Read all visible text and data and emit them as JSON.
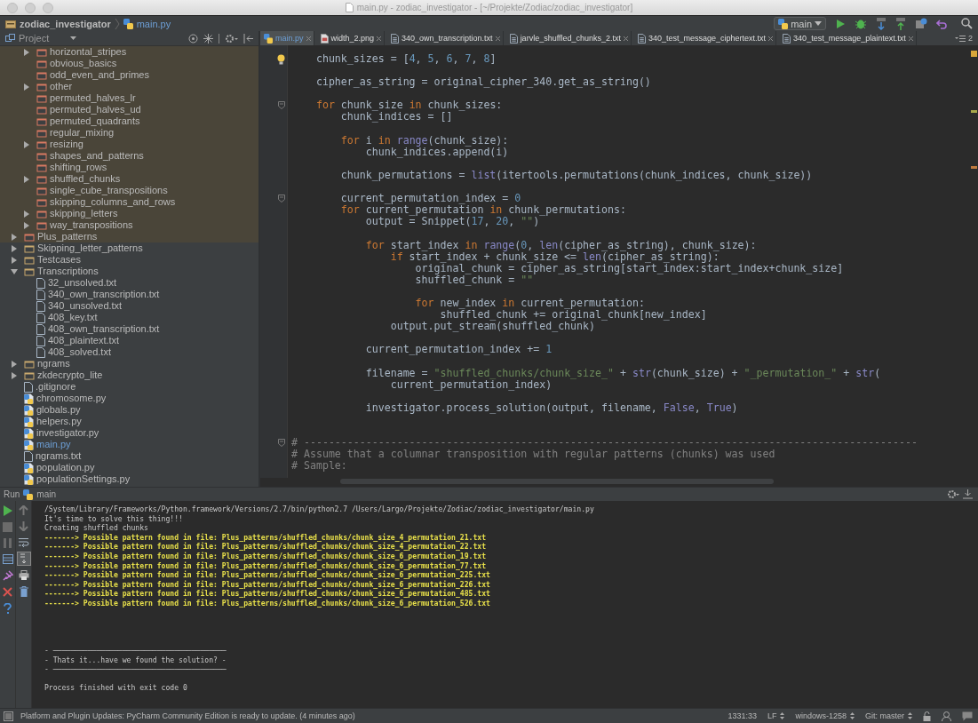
{
  "window": {
    "title": "main.py - zodiac_investigator - [~/Projekte/Zodiac/zodiac_investigator]"
  },
  "breadcrumb": [
    {
      "label": "zodiac_investigator",
      "kind": "folder"
    },
    {
      "label": "main.py",
      "kind": "python"
    }
  ],
  "run_config": "main",
  "project_panel": {
    "title": "Project"
  },
  "tree": [
    {
      "children": [
        {
          "label": "horizontal_stripes",
          "kind": "excluded_folder",
          "expanded": false,
          "highlighted": true
        },
        {
          "label": "obvious_basics",
          "kind": "excluded_folder",
          "highlighted": true
        },
        {
          "label": "odd_even_and_primes",
          "kind": "excluded_folder",
          "highlighted": true
        },
        {
          "label": "other",
          "kind": "excluded_folder",
          "expanded": false,
          "highlighted": true
        },
        {
          "label": "permuted_halves_lr",
          "kind": "excluded_folder",
          "highlighted": true
        },
        {
          "label": "permuted_halves_ud",
          "kind": "excluded_folder",
          "highlighted": true
        },
        {
          "label": "permuted_quadrants",
          "kind": "excluded_folder",
          "highlighted": true
        },
        {
          "label": "regular_mixing",
          "kind": "excluded_folder",
          "highlighted": true
        },
        {
          "label": "resizing",
          "kind": "excluded_folder",
          "expanded": false,
          "highlighted": true
        },
        {
          "label": "shapes_and_patterns",
          "kind": "excluded_folder",
          "highlighted": true
        },
        {
          "label": "shifting_rows",
          "kind": "excluded_folder",
          "highlighted": true
        },
        {
          "label": "shuffled_chunks",
          "kind": "excluded_folder",
          "expanded": false,
          "highlighted": true
        },
        {
          "label": "single_cube_transpositions",
          "kind": "excluded_folder",
          "highlighted": true
        },
        {
          "label": "skipping_columns_and_rows",
          "kind": "excluded_folder",
          "highlighted": true
        },
        {
          "label": "skipping_letters",
          "kind": "excluded_folder",
          "expanded": false,
          "highlighted": true
        },
        {
          "label": "way_transpositions",
          "kind": "excluded_folder",
          "expanded": false,
          "highlighted": true
        }
      ]
    },
    {
      "label": "Plus_patterns",
      "kind": "excluded_folder",
      "expanded": false,
      "highlighted": true
    },
    {
      "label": "Skipping_letter_patterns",
      "kind": "folder",
      "expanded": false,
      "highlighted": false
    },
    {
      "label": "Testcases",
      "kind": "folder",
      "expanded": false,
      "highlighted": false
    },
    {
      "label": "Transcriptions",
      "kind": "folder",
      "expanded": true,
      "highlighted": false,
      "children": [
        {
          "label": "32_unsolved.txt",
          "kind": "text",
          "highlighted": false,
          "active": false
        },
        {
          "label": "340_own_transcription.txt",
          "kind": "text",
          "highlighted": false,
          "active": false
        },
        {
          "label": "340_unsolved.txt",
          "kind": "text",
          "highlighted": false,
          "active": false
        },
        {
          "label": "408_key.txt",
          "kind": "text",
          "highlighted": false,
          "active": false
        },
        {
          "label": "408_own_transcription.txt",
          "kind": "text",
          "highlighted": false,
          "active": false
        },
        {
          "label": "408_plaintext.txt",
          "kind": "text",
          "highlighted": false,
          "active": false
        },
        {
          "label": "408_solved.txt",
          "kind": "text",
          "highlighted": false,
          "active": false
        }
      ]
    },
    {
      "label": "ngrams",
      "kind": "folder",
      "expanded": false,
      "highlighted": false
    },
    {
      "label": "zkdecrypto_lite",
      "kind": "folder",
      "expanded": false,
      "highlighted": false
    },
    {
      "label": ".gitignore",
      "kind": "text",
      "highlighted": false,
      "active": false
    },
    {
      "label": "chromosome.py",
      "kind": "python",
      "highlighted": false,
      "active": false
    },
    {
      "label": "globals.py",
      "kind": "python",
      "highlighted": false,
      "active": false
    },
    {
      "label": "helpers.py",
      "kind": "python",
      "highlighted": false,
      "active": false
    },
    {
      "label": "investigator.py",
      "kind": "python",
      "highlighted": false,
      "active": false
    },
    {
      "label": "main.py",
      "kind": "python",
      "highlighted": false,
      "active": true
    },
    {
      "label": "ngrams.txt",
      "kind": "text",
      "highlighted": false,
      "active": false
    },
    {
      "label": "population.py",
      "kind": "python",
      "highlighted": false,
      "active": false
    },
    {
      "label": "populationSettings.py",
      "kind": "python",
      "highlighted": false,
      "active": false
    }
  ],
  "tabs": [
    {
      "label": "main.py",
      "kind": "python",
      "selected": true
    },
    {
      "label": "width_2.png",
      "kind": "image",
      "selected": false
    },
    {
      "label": "340_own_transcription.txt",
      "kind": "text",
      "selected": false
    },
    {
      "label": "jarvle_shuffled_chunks_2.txt",
      "kind": "text",
      "selected": false
    },
    {
      "label": "340_test_message_ciphertext.txt",
      "kind": "text",
      "selected": false
    },
    {
      "label": "340_test_message_plaintext.txt",
      "kind": "text",
      "selected": false
    }
  ],
  "tab_overflow_count": "2",
  "code": [
    {
      "kind": "code",
      "lightbulb": true,
      "tokens": [
        {
          "text": "    chunk_sizes = [",
          "kind": "plain"
        },
        {
          "text": "4",
          "kind": "number"
        },
        {
          "text": ", ",
          "kind": "plain"
        },
        {
          "text": "5",
          "kind": "number"
        },
        {
          "text": ", ",
          "kind": "plain"
        },
        {
          "text": "6",
          "kind": "number"
        },
        {
          "text": ", ",
          "kind": "plain"
        },
        {
          "text": "7",
          "kind": "number"
        },
        {
          "text": ", ",
          "kind": "plain"
        },
        {
          "text": "8",
          "kind": "number"
        },
        {
          "text": "]",
          "kind": "plain"
        }
      ]
    },
    {
      "kind": "blank"
    },
    {
      "kind": "code",
      "tokens": [
        {
          "text": "    cipher_as_string = original_cipher_340.get_as_string()",
          "kind": "plain"
        }
      ]
    },
    {
      "kind": "blank"
    },
    {
      "kind": "code",
      "foldable": true,
      "tokens": [
        {
          "text": "    for",
          "kind": "keyword"
        },
        {
          "text": " chunk_size ",
          "kind": "plain"
        },
        {
          "text": "in",
          "kind": "keyword"
        },
        {
          "text": " chunk_sizes:",
          "kind": "plain"
        }
      ]
    },
    {
      "kind": "code",
      "tokens": [
        {
          "text": "        chunk_indices = []",
          "kind": "plain"
        }
      ]
    },
    {
      "kind": "blank"
    },
    {
      "kind": "code",
      "tokens": [
        {
          "text": "        for",
          "kind": "keyword"
        },
        {
          "text": " i ",
          "kind": "plain"
        },
        {
          "text": "in",
          "kind": "keyword"
        },
        {
          "text": " range",
          "kind": "builtin"
        },
        {
          "text": "(chunk_size):",
          "kind": "plain"
        }
      ]
    },
    {
      "kind": "code",
      "tokens": [
        {
          "text": "            chunk_indices.append(i)",
          "kind": "plain"
        }
      ]
    },
    {
      "kind": "blank"
    },
    {
      "kind": "code",
      "tokens": [
        {
          "text": "        chunk_permutations = ",
          "kind": "plain"
        },
        {
          "text": "list",
          "kind": "builtin"
        },
        {
          "text": "(itertools.permutations(chunk_indices, chunk_size))",
          "kind": "plain"
        }
      ]
    },
    {
      "kind": "blank"
    },
    {
      "kind": "code",
      "foldable": true,
      "tokens": [
        {
          "text": "        current_permutation_index = ",
          "kind": "plain"
        },
        {
          "text": "0",
          "kind": "number"
        }
      ]
    },
    {
      "kind": "code",
      "tokens": [
        {
          "text": "        for",
          "kind": "keyword"
        },
        {
          "text": " current_permutation ",
          "kind": "plain"
        },
        {
          "text": "in",
          "kind": "keyword"
        },
        {
          "text": " chunk_permutations:",
          "kind": "plain"
        }
      ]
    },
    {
      "kind": "code",
      "tokens": [
        {
          "text": "            output = Snippet(",
          "kind": "plain"
        },
        {
          "text": "17",
          "kind": "number"
        },
        {
          "text": ", ",
          "kind": "plain"
        },
        {
          "text": "20",
          "kind": "number"
        },
        {
          "text": ", ",
          "kind": "plain"
        },
        {
          "text": "\"\"",
          "kind": "string"
        },
        {
          "text": ")",
          "kind": "plain"
        }
      ]
    },
    {
      "kind": "blank"
    },
    {
      "kind": "code",
      "tokens": [
        {
          "text": "            for",
          "kind": "keyword"
        },
        {
          "text": " start_index ",
          "kind": "plain"
        },
        {
          "text": "in",
          "kind": "keyword"
        },
        {
          "text": " range",
          "kind": "builtin"
        },
        {
          "text": "(",
          "kind": "plain"
        },
        {
          "text": "0",
          "kind": "number"
        },
        {
          "text": ", ",
          "kind": "plain"
        },
        {
          "text": "len",
          "kind": "builtin"
        },
        {
          "text": "(cipher_as_string), chunk_size):",
          "kind": "plain"
        }
      ]
    },
    {
      "kind": "code",
      "tokens": [
        {
          "text": "                if",
          "kind": "keyword"
        },
        {
          "text": " start_index + chunk_size <= ",
          "kind": "plain"
        },
        {
          "text": "len",
          "kind": "builtin"
        },
        {
          "text": "(cipher_as_string):",
          "kind": "plain"
        }
      ]
    },
    {
      "kind": "code",
      "tokens": [
        {
          "text": "                    original_chunk = cipher_as_string[start_index:start_index+chunk_size]",
          "kind": "plain"
        }
      ]
    },
    {
      "kind": "code",
      "tokens": [
        {
          "text": "                    shuffled_chunk = ",
          "kind": "plain"
        },
        {
          "text": "\"\"",
          "kind": "string"
        }
      ]
    },
    {
      "kind": "blank"
    },
    {
      "kind": "code",
      "tokens": [
        {
          "text": "                    for",
          "kind": "keyword"
        },
        {
          "text": " new_index ",
          "kind": "plain"
        },
        {
          "text": "in",
          "kind": "keyword"
        },
        {
          "text": " current_permutation:",
          "kind": "plain"
        }
      ]
    },
    {
      "kind": "code",
      "tokens": [
        {
          "text": "                        shuffled_chunk += original_chunk[new_index]",
          "kind": "plain"
        }
      ]
    },
    {
      "kind": "code",
      "tokens": [
        {
          "text": "                output.put_stream(shuffled_chunk)",
          "kind": "plain"
        }
      ]
    },
    {
      "kind": "blank"
    },
    {
      "kind": "code",
      "tokens": [
        {
          "text": "            current_permutation_index += ",
          "kind": "plain"
        },
        {
          "text": "1",
          "kind": "number"
        }
      ]
    },
    {
      "kind": "blank"
    },
    {
      "kind": "code",
      "tokens": [
        {
          "text": "            filename = ",
          "kind": "plain"
        },
        {
          "text": "\"shuffled_chunks/chunk_size_\"",
          "kind": "string"
        },
        {
          "text": " + ",
          "kind": "plain"
        },
        {
          "text": "str",
          "kind": "builtin"
        },
        {
          "text": "(chunk_size) + ",
          "kind": "plain"
        },
        {
          "text": "\"_permutation_\"",
          "kind": "string"
        },
        {
          "text": " + ",
          "kind": "plain"
        },
        {
          "text": "str",
          "kind": "builtin"
        },
        {
          "text": "(",
          "kind": "plain"
        }
      ]
    },
    {
      "kind": "code",
      "tokens": [
        {
          "text": "                current_permutation_index)",
          "kind": "plain"
        }
      ]
    },
    {
      "kind": "blank"
    },
    {
      "kind": "code",
      "tokens": [
        {
          "text": "            investigator.process_solution(output, filename, ",
          "kind": "plain"
        },
        {
          "text": "False",
          "kind": "builtin"
        },
        {
          "text": ", ",
          "kind": "plain"
        },
        {
          "text": "True",
          "kind": "builtin"
        },
        {
          "text": ")",
          "kind": "plain"
        }
      ]
    },
    {
      "kind": "blank"
    },
    {
      "kind": "blank"
    },
    {
      "kind": "code",
      "foldable": true,
      "tokens": [
        {
          "text": "# ---------------------------------------------------------------------------------------------------",
          "kind": "comment"
        }
      ]
    },
    {
      "kind": "code",
      "tokens": [
        {
          "text": "# Assume that a columnar transposition with regular patterns (chunks) was used",
          "kind": "comment"
        }
      ]
    },
    {
      "kind": "code",
      "tokens": [
        {
          "text": "# Sample:",
          "kind": "comment"
        }
      ]
    }
  ],
  "run_panel": {
    "label": "Run",
    "config": "main"
  },
  "console": [
    {
      "text": "/System/Library/Frameworks/Python.framework/Versions/2.7/bin/python2.7 /Users/Largo/Projekte/Zodiac/zodiac_investigator/main.py",
      "kind": "plain"
    },
    {
      "text": "It's time to solve this thing!!!",
      "kind": "plain"
    },
    {
      "text": "Creating shuffled chunks",
      "kind": "plain"
    },
    {
      "text": "-------> Possible pattern found in file: Plus_patterns/shuffled_chunks/chunk_size_4_permutation_21.txt",
      "kind": "match"
    },
    {
      "text": "-------> Possible pattern found in file: Plus_patterns/shuffled_chunks/chunk_size_4_permutation_22.txt",
      "kind": "match"
    },
    {
      "text": "-------> Possible pattern found in file: Plus_patterns/shuffled_chunks/chunk_size_6_permutation_19.txt",
      "kind": "match"
    },
    {
      "text": "-------> Possible pattern found in file: Plus_patterns/shuffled_chunks/chunk_size_6_permutation_77.txt",
      "kind": "match"
    },
    {
      "text": "-------> Possible pattern found in file: Plus_patterns/shuffled_chunks/chunk_size_6_permutation_225.txt",
      "kind": "match"
    },
    {
      "text": "-------> Possible pattern found in file: Plus_patterns/shuffled_chunks/chunk_size_6_permutation_226.txt",
      "kind": "match"
    },
    {
      "text": "-------> Possible pattern found in file: Plus_patterns/shuffled_chunks/chunk_size_6_permutation_485.txt",
      "kind": "match"
    },
    {
      "text": "-------> Possible pattern found in file: Plus_patterns/shuffled_chunks/chunk_size_6_permutation_526.txt",
      "kind": "match"
    },
    {
      "kind": "blank"
    },
    {
      "kind": "blank"
    },
    {
      "kind": "blank"
    },
    {
      "kind": "blank"
    },
    {
      "text": "- ────────────────────────────────────────",
      "kind": "plain"
    },
    {
      "text": "- Thats it...have we found the solution? -",
      "kind": "plain"
    },
    {
      "text": "- ────────────────────────────────────────",
      "kind": "plain"
    },
    {
      "kind": "blank"
    },
    {
      "text": "Process finished with exit code 0",
      "kind": "plain"
    }
  ],
  "status_bar": {
    "message": "Platform and Plugin Updates: PyCharm Community Edition is ready to update. (4 minutes ago)",
    "position": "1331:33",
    "line_separator": "LF",
    "encoding": "windows-1258",
    "vcs_branch": "Git: master"
  }
}
